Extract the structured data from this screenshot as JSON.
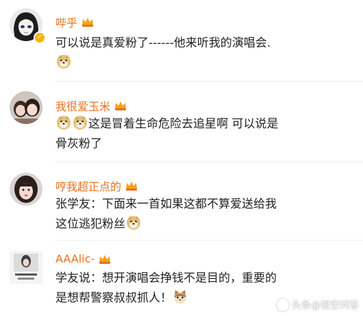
{
  "comments": [
    {
      "username": "哔乎",
      "line1": "可以说是真爱粉了------他来听我的演唱会.",
      "line2": ""
    },
    {
      "username": "我很爱玉米",
      "line1": "这是冒着生命危险去追星啊 可以说是",
      "line2": "骨灰粉了"
    },
    {
      "username": "哼我超正点的",
      "line1": "张学友：下面来一首如果这都不算爱送给我",
      "line2": "这位逃犯粉丝"
    },
    {
      "username": "AAAlic-",
      "line1": "学友说：想开演唱会挣钱不是目的，重要的",
      "line2": "是想帮警察叔叔抓人！"
    }
  ],
  "watermark": {
    "text": "头条@悟空问答"
  },
  "colors": {
    "username": "#e8711d",
    "text": "#222222",
    "divider": "#ededed",
    "verified": "#f6b500"
  },
  "icons": {
    "emoji_doge": "doge-emoji-icon",
    "emoji_cat": "cat-emoji-icon",
    "vip_badge": "vip-crown-icon",
    "verified": "verified-badge-icon"
  }
}
